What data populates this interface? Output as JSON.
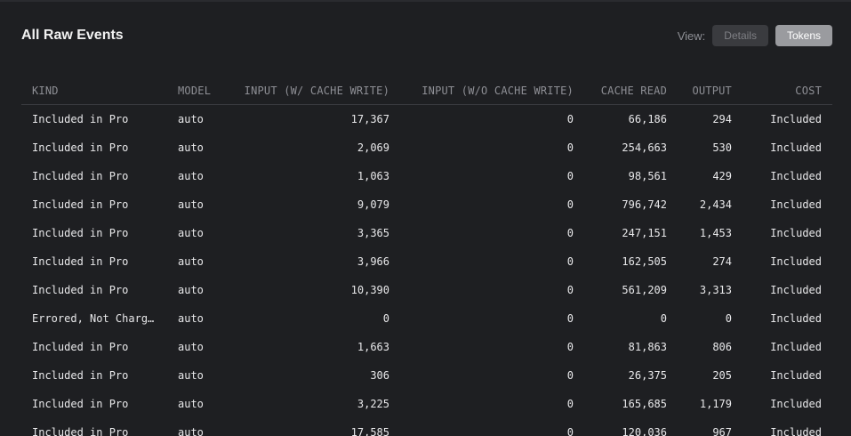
{
  "header": {
    "title": "All Raw Events",
    "view_label": "View:",
    "details_label": "Details",
    "tokens_label": "Tokens"
  },
  "table": {
    "columns": [
      "KIND",
      "MODEL",
      "INPUT (W/ CACHE WRITE)",
      "INPUT (W/O CACHE WRITE)",
      "CACHE READ",
      "OUTPUT",
      "COST"
    ],
    "rows": [
      [
        "Included in Pro",
        "auto",
        "17,367",
        "0",
        "66,186",
        "294",
        "Included"
      ],
      [
        "Included in Pro",
        "auto",
        "2,069",
        "0",
        "254,663",
        "530",
        "Included"
      ],
      [
        "Included in Pro",
        "auto",
        "1,063",
        "0",
        "98,561",
        "429",
        "Included"
      ],
      [
        "Included in Pro",
        "auto",
        "9,079",
        "0",
        "796,742",
        "2,434",
        "Included"
      ],
      [
        "Included in Pro",
        "auto",
        "3,365",
        "0",
        "247,151",
        "1,453",
        "Included"
      ],
      [
        "Included in Pro",
        "auto",
        "3,966",
        "0",
        "162,505",
        "274",
        "Included"
      ],
      [
        "Included in Pro",
        "auto",
        "10,390",
        "0",
        "561,209",
        "3,313",
        "Included"
      ],
      [
        "Errored, Not Charg…",
        "auto",
        "0",
        "0",
        "0",
        "0",
        "Included"
      ],
      [
        "Included in Pro",
        "auto",
        "1,663",
        "0",
        "81,863",
        "806",
        "Included"
      ],
      [
        "Included in Pro",
        "auto",
        "306",
        "0",
        "26,375",
        "205",
        "Included"
      ],
      [
        "Included in Pro",
        "auto",
        "3,225",
        "0",
        "165,685",
        "1,179",
        "Included"
      ],
      [
        "Included in Pro",
        "auto",
        "17,585",
        "0",
        "120,036",
        "967",
        "Included"
      ]
    ]
  }
}
